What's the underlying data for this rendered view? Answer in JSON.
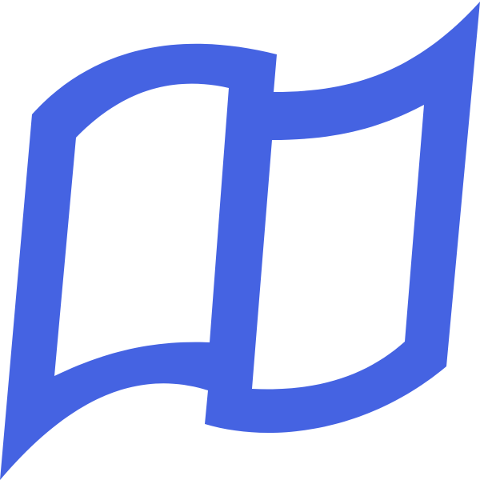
{
  "icon": {
    "name": "window-flag-icon",
    "color": "#4563E2"
  },
  "background_color": "#FFFFFF"
}
